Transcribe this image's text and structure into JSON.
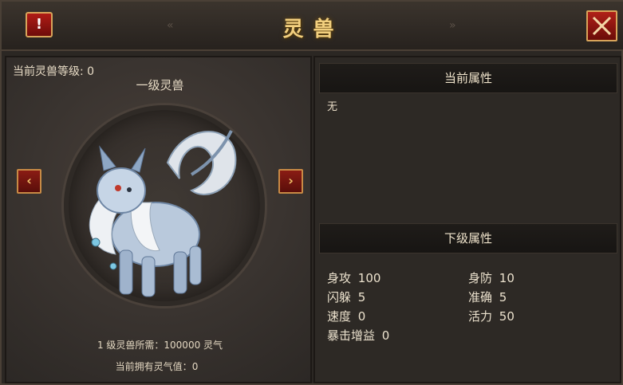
{
  "window": {
    "title": "灵兽",
    "alert_icon": "!"
  },
  "pet": {
    "current_level_label": "当前灵兽等级:",
    "current_level_value": "0",
    "name": "一级灵兽",
    "requirement_label": "1 级灵兽所需：",
    "requirement_value": "100000 灵气",
    "owned_label": "当前拥有灵气值：",
    "owned_value": "0"
  },
  "current_attrs": {
    "header": "当前属性",
    "empty_text": "无"
  },
  "next_attrs": {
    "header": "下级属性",
    "stats": [
      {
        "label": "身攻",
        "value": "100"
      },
      {
        "label": "身防",
        "value": "10"
      },
      {
        "label": "闪躲",
        "value": "5"
      },
      {
        "label": "准确",
        "value": "5"
      },
      {
        "label": "速度",
        "value": "0"
      },
      {
        "label": "活力",
        "value": "50"
      },
      {
        "label": "暴击增益",
        "value": "0"
      }
    ]
  },
  "icons": {
    "prev": "chevron-left-icon",
    "next": "chevron-right-icon",
    "close": "close-icon",
    "alert": "alert-icon"
  },
  "colors": {
    "title_gold": "#f2cf7e",
    "button_red": "#8a1c14",
    "button_border": "#c88a45",
    "panel_bg": "#2d2925"
  }
}
